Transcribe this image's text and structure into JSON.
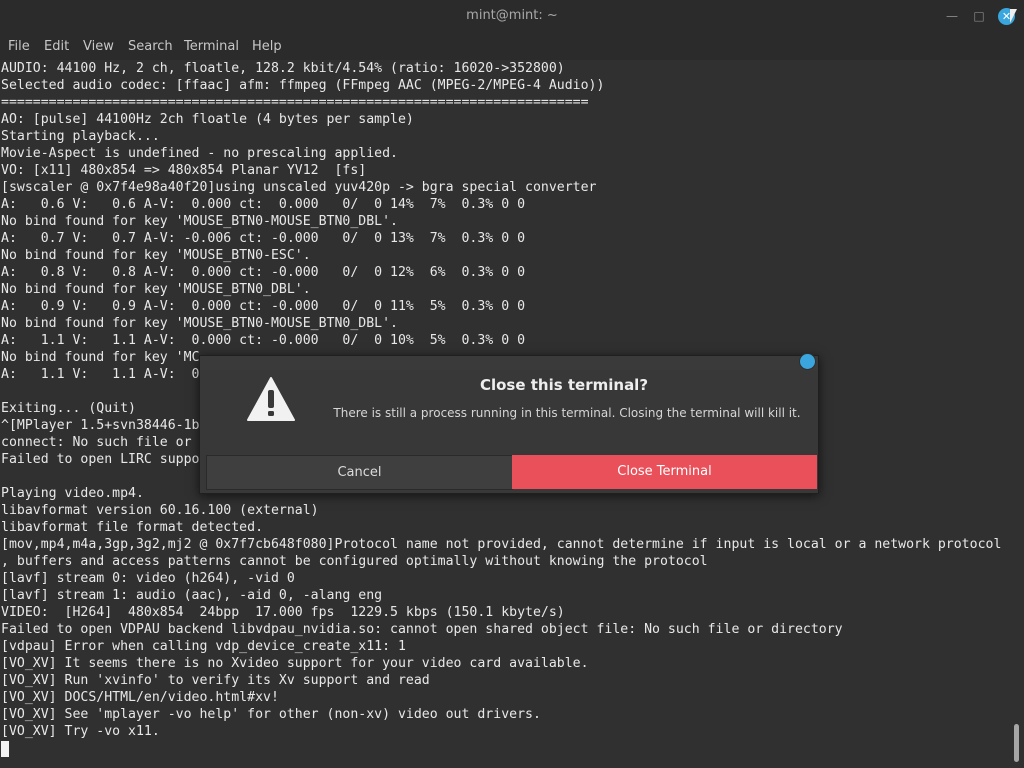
{
  "window": {
    "title": "mint@mint: ~",
    "minimize_icon": "minimize-icon",
    "maximize_icon": "maximize-icon",
    "close_icon": "close-icon",
    "close_color": "#3aa6dd"
  },
  "menu": {
    "items": [
      "File",
      "Edit",
      "View",
      "Search",
      "Terminal",
      "Help"
    ]
  },
  "terminal": {
    "lines": [
      "AUDIO: 44100 Hz, 2 ch, floatle, 128.2 kbit/4.54% (ratio: 16020->352800)",
      "Selected audio codec: [ffaac] afm: ffmpeg (FFmpeg AAC (MPEG-2/MPEG-4 Audio))",
      "==========================================================================",
      "AO: [pulse] 44100Hz 2ch floatle (4 bytes per sample)",
      "Starting playback...",
      "Movie-Aspect is undefined - no prescaling applied.",
      "VO: [x11] 480x854 => 480x854 Planar YV12  [fs]",
      "[swscaler @ 0x7f4e98a40f20]using unscaled yuv420p -> bgra special converter",
      "A:   0.6 V:   0.6 A-V:  0.000 ct:  0.000   0/  0 14%  7%  0.3% 0 0",
      "No bind found for key 'MOUSE_BTN0-MOUSE_BTN0_DBL'.",
      "A:   0.7 V:   0.7 A-V: -0.006 ct: -0.000   0/  0 13%  7%  0.3% 0 0",
      "No bind found for key 'MOUSE_BTN0-ESC'.",
      "A:   0.8 V:   0.8 A-V:  0.000 ct: -0.000   0/  0 12%  6%  0.3% 0 0",
      "No bind found for key 'MOUSE_BTN0_DBL'.",
      "A:   0.9 V:   0.9 A-V:  0.000 ct: -0.000   0/  0 11%  5%  0.3% 0 0",
      "No bind found for key 'MOUSE_BTN0-MOUSE_BTN0_DBL'.",
      "A:   1.1 V:   1.1 A-V:  0.000 ct: -0.000   0/  0 10%  5%  0.3% 0 0",
      "No bind found for key 'MC",
      "A:   1.1 V:   1.1 A-V:  0",
      "",
      "Exiting... (Quit)",
      "^[MPlayer 1.5+svn38446-1b",
      "connect: No such file or",
      "Failed to open LIRC suppo",
      "",
      "Playing video.mp4.",
      "libavformat version 60.16.100 (external)",
      "libavformat file format detected.",
      "[mov,mp4,m4a,3gp,3g2,mj2 @ 0x7f7cb648f080]Protocol name not provided, cannot determine if input is local or a network protocol",
      ", buffers and access patterns cannot be configured optimally without knowing the protocol",
      "[lavf] stream 0: video (h264), -vid 0",
      "[lavf] stream 1: audio (aac), -aid 0, -alang eng",
      "VIDEO:  [H264]  480x854  24bpp  17.000 fps  1229.5 kbps (150.1 kbyte/s)",
      "Failed to open VDPAU backend libvdpau_nvidia.so: cannot open shared object file: No such file or directory",
      "[vdpau] Error when calling vdp_device_create_x11: 1",
      "[VO_XV] It seems there is no Xvideo support for your video card available.",
      "[VO_XV] Run 'xvinfo' to verify its Xv support and read",
      "[VO_XV] DOCS/HTML/en/video.html#xv!",
      "[VO_XV] See 'mplayer -vo help' for other (non-xv) video out drivers.",
      "[VO_XV] Try -vo x11."
    ]
  },
  "dialog": {
    "heading": "Close this terminal?",
    "message": "There is still a process running in this terminal. Closing the terminal will kill it.",
    "cancel_label": "Cancel",
    "confirm_label": "Close Terminal",
    "warning_icon": "warning-icon",
    "confirm_color": "#e9505a"
  }
}
